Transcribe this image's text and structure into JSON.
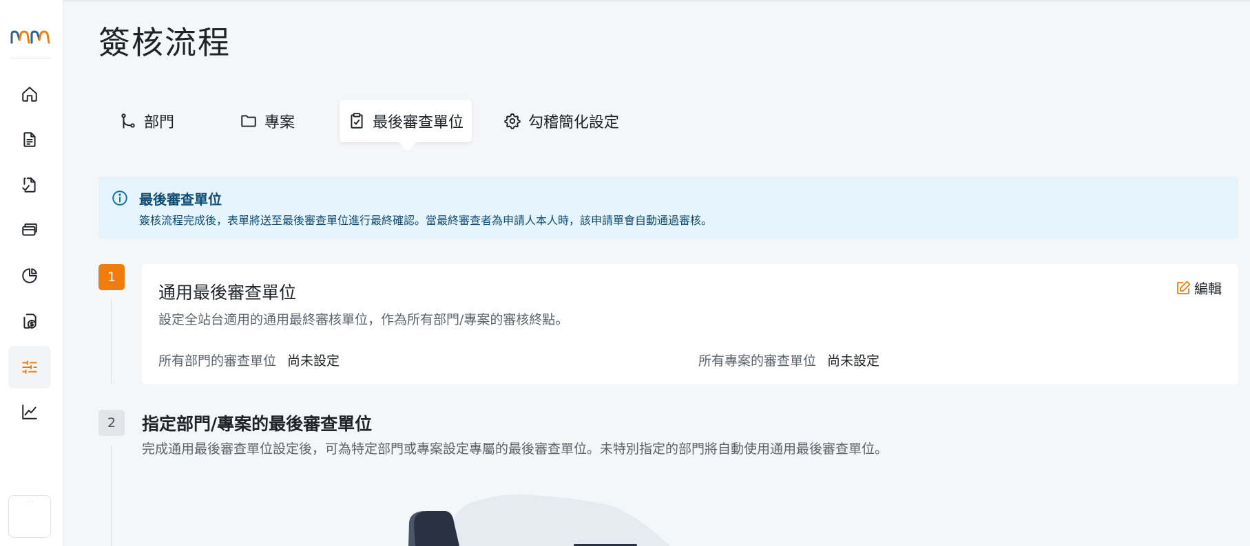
{
  "page": {
    "title": "簽核流程"
  },
  "sidebar": {
    "items": [
      {
        "name": "home",
        "icon": "home-icon"
      },
      {
        "name": "documents",
        "icon": "document-icon"
      },
      {
        "name": "review",
        "icon": "file-check-icon"
      },
      {
        "name": "cards",
        "icon": "cards-icon"
      },
      {
        "name": "reports",
        "icon": "pie-chart-icon"
      },
      {
        "name": "payments",
        "icon": "money-doc-icon"
      },
      {
        "name": "settings",
        "icon": "sliders-icon",
        "active": true
      },
      {
        "name": "analytics",
        "icon": "line-chart-icon"
      }
    ],
    "avatar_text": "···"
  },
  "tabs": [
    {
      "label": "部門",
      "icon": "branch-icon"
    },
    {
      "label": "專案",
      "icon": "folder-icon"
    },
    {
      "label": "最後審查單位",
      "icon": "clipboard-check-icon",
      "active": true
    },
    {
      "label": "勾稽簡化設定",
      "icon": "gear-icon"
    }
  ],
  "info": {
    "title": "最後審查單位",
    "text": "簽核流程完成後，表單將送至最後審查單位進行最終確認。當最終審查者為申請人本人時，該申請單會自動通過審核。"
  },
  "step1": {
    "number": "1",
    "title": "通用最後審查單位",
    "description": "設定全站台適用的通用最終審核單位，作為所有部門/專案的審核終點。",
    "edit_label": "編輯",
    "dept_label": "所有部門的審查單位",
    "dept_value": "尚未設定",
    "proj_label": "所有專案的審查單位",
    "proj_value": "尚未設定"
  },
  "step2": {
    "number": "2",
    "title": "指定部門/專案的最後審查單位",
    "description": "完成通用最後審查單位設定後，可為特定部門或專案設定專屬的最後審查單位。未特別指定的部門將自動使用通用最後審查單位。"
  },
  "colors": {
    "accent": "#f07c0e",
    "info_bg": "#e4f4fa",
    "info_text": "#0f4c75",
    "logo_blue": "#2f5f8a",
    "logo_orange": "#f07c0e"
  }
}
